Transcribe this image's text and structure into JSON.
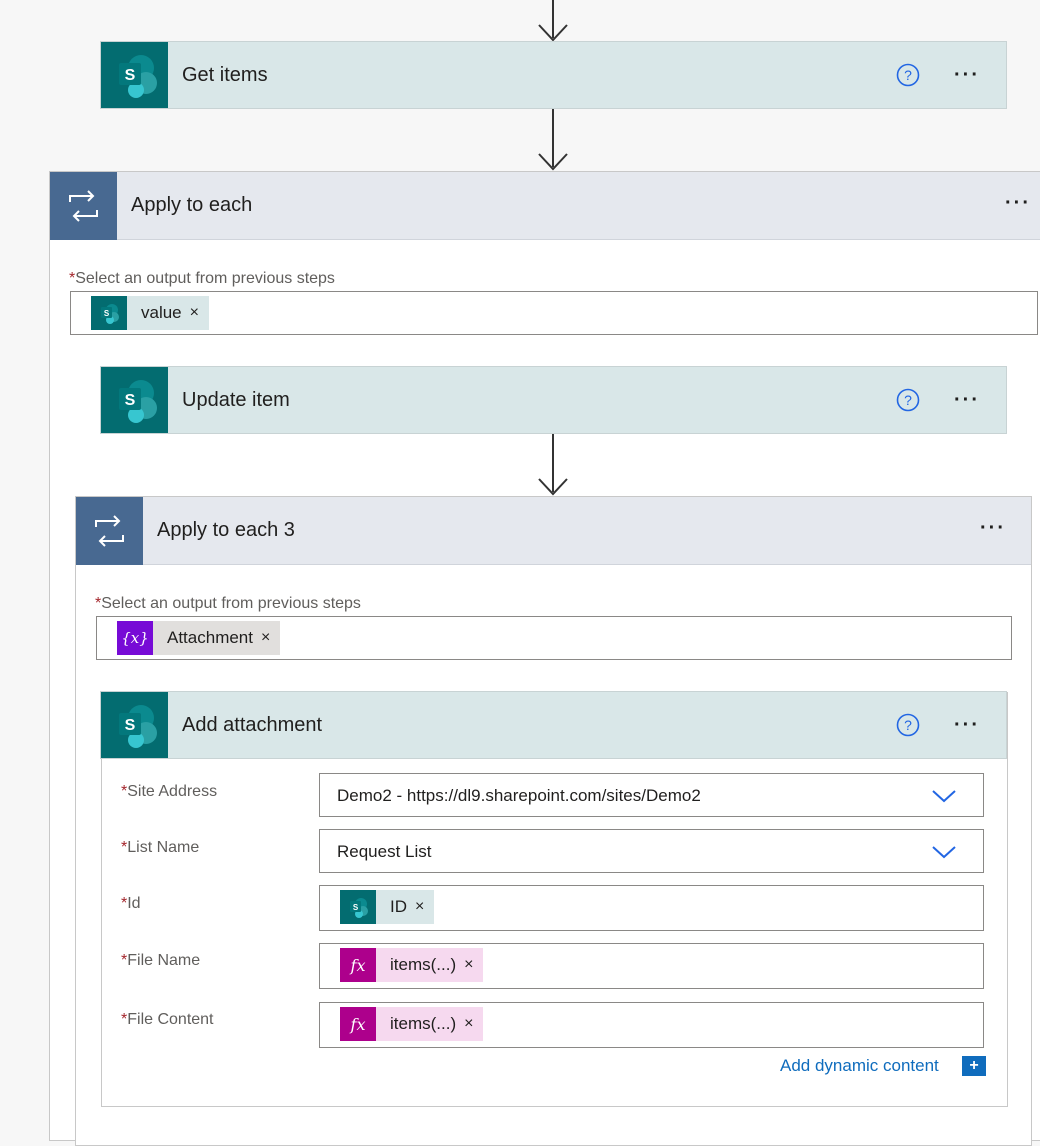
{
  "get_items": {
    "title": "Get items",
    "help_icon": "help-circle-icon",
    "more": "···"
  },
  "apply_each": {
    "title": "Apply to each",
    "more": "···",
    "output_label": "Select an output from previous steps",
    "token": "value"
  },
  "update_item": {
    "title": "Update item",
    "more": "···"
  },
  "apply_each_3": {
    "title": "Apply to each 3",
    "more": "···",
    "output_label": "Select an output from previous steps",
    "token": "Attachment"
  },
  "add_attachment": {
    "title": "Add attachment",
    "more": "···",
    "fields": {
      "site_address": {
        "label": "Site Address",
        "value": "Demo2 - https://dl9.sharepoint.com/sites/Demo2"
      },
      "list_name": {
        "label": "List Name",
        "value": "Request List"
      },
      "id": {
        "label": "Id",
        "token": "ID"
      },
      "file_name": {
        "label": "File Name",
        "token": "items(...)"
      },
      "file_content": {
        "label": "File Content",
        "token": "items(...)"
      }
    },
    "add_dynamic": "Add dynamic content"
  },
  "token_remove": "×",
  "colors": {
    "sharepoint": "#036c70",
    "loop": "#486991",
    "variable": "#770bd6",
    "expression": "#ad008c",
    "link": "#0f6cbd"
  }
}
